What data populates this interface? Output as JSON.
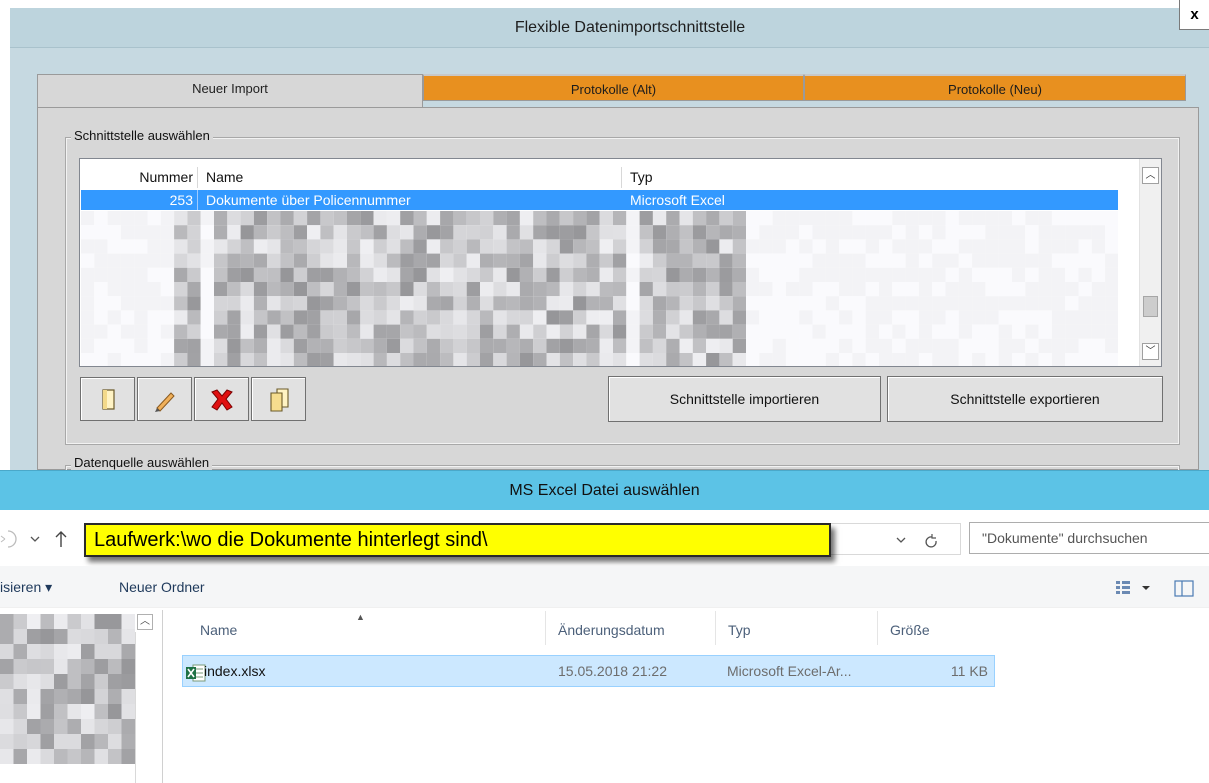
{
  "top_dialog": {
    "title": "Flexible Datenimportschnittstelle",
    "close_label": "x",
    "tabs": [
      {
        "label": "Neuer Import",
        "active": true
      },
      {
        "label": "Protokolle (Alt)",
        "active": false
      },
      {
        "label": "Protokolle (Neu)",
        "active": false
      }
    ],
    "group_interface": {
      "label": "Schnittstelle auswählen",
      "columns": [
        "Nummer",
        "Name",
        "Typ"
      ],
      "selected_row": {
        "nummer": "253",
        "name": "Dokumente über Policennummer",
        "typ": "Microsoft Excel"
      }
    },
    "buttons": {
      "new_icon": "new-document-icon",
      "edit_icon": "pencil-icon",
      "delete_icon": "red-x-icon",
      "copy_icon": "copy-document-icon",
      "import_label": "Schnittstelle importieren",
      "export_label": "Schnittstelle exportieren"
    },
    "group_datasource": {
      "label": "Datenquelle auswählen"
    }
  },
  "file_dialog": {
    "title": "MS Excel Datei auswählen",
    "path_annotation": "Laufwerk:\\wo die Dokumente hinterlegt sind\\",
    "search_placeholder": "\"Dokumente\" durchsuchen",
    "toolbar": {
      "organize_label": "isieren ▾",
      "new_folder_label": "Neuer Ordner"
    },
    "columns": {
      "name": "Name",
      "date": "Änderungsdatum",
      "type": "Typ",
      "size": "Größe"
    },
    "files": [
      {
        "name": "index.xlsx",
        "date": "15.05.2018 21:22",
        "type": "Microsoft Excel-Ar...",
        "size": "11 KB"
      }
    ]
  },
  "colors": {
    "tab_orange": "#e8901f",
    "selection_blue": "#3399ff",
    "file_dialog_title": "#5cc3e6",
    "annotation_yellow": "#ffff00"
  }
}
